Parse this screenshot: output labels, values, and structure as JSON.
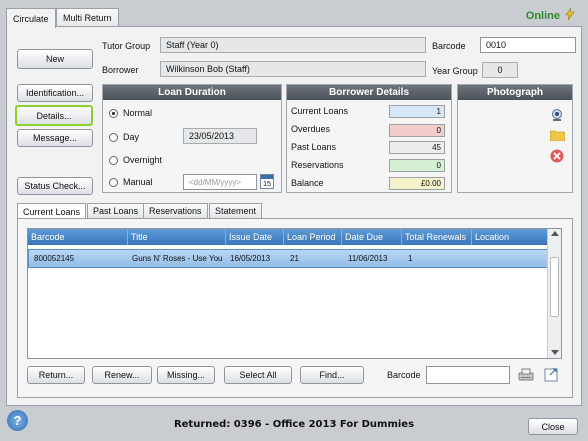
{
  "tabs": [
    "Circulate",
    "Multi Return"
  ],
  "status_online": "Online",
  "buttons": {
    "new": "New",
    "identification": "Identification...",
    "details": "Details...",
    "message": "Message...",
    "status_check": "Status Check..."
  },
  "tutor_group": {
    "label": "Tutor Group",
    "value": "Staff (Year 0)"
  },
  "borrower": {
    "label": "Borrower",
    "value": "Wilkinson Bob (Staff)"
  },
  "barcode_top": {
    "label": "Barcode",
    "value": "0010"
  },
  "year_group": {
    "label": "Year Group",
    "value": "0"
  },
  "loan_duration": {
    "title": "Loan Duration",
    "options": [
      "Normal",
      "Day",
      "Overnight",
      "Manual"
    ],
    "selected": "Normal",
    "day_value": "23/05/2013",
    "manual_placeholder": "<dd/MM/yyyy>",
    "calendar_day": "15"
  },
  "borrower_details": {
    "title": "Borrower Details",
    "rows": [
      {
        "label": "Current Loans",
        "value": "1",
        "color": "#d6e6f7"
      },
      {
        "label": "Overdues",
        "value": "0",
        "color": "#f4cccc"
      },
      {
        "label": "Past Loans",
        "value": "45",
        "color": "#ededed"
      },
      {
        "label": "Reservations",
        "value": "0",
        "color": "#d3f0d3"
      },
      {
        "label": "Balance",
        "value": "£0.00",
        "color": "#f4f3c9"
      }
    ]
  },
  "photograph": {
    "title": "Photograph"
  },
  "subtabs": [
    "Current Loans",
    "Past Loans",
    "Reservations",
    "Statement"
  ],
  "table": {
    "columns": [
      "Barcode",
      "Title",
      "Issue Date",
      "Loan Period",
      "Date Due",
      "Total Renewals",
      "Location"
    ],
    "rows": [
      [
        "800052145",
        "Guns N' Roses - Use You",
        "16/05/2013",
        "21",
        "11/06/2013",
        "1",
        ""
      ]
    ]
  },
  "bottom_buttons": {
    "return": "Return...",
    "renew": "Renew...",
    "missing": "Missing...",
    "select_all": "Select All",
    "find": "Find..."
  },
  "barcode_bottom": {
    "label": "Barcode",
    "value": ""
  },
  "status_message": "Returned: 0396 - Office 2013 For Dummies",
  "close": "Close",
  "help": "?"
}
